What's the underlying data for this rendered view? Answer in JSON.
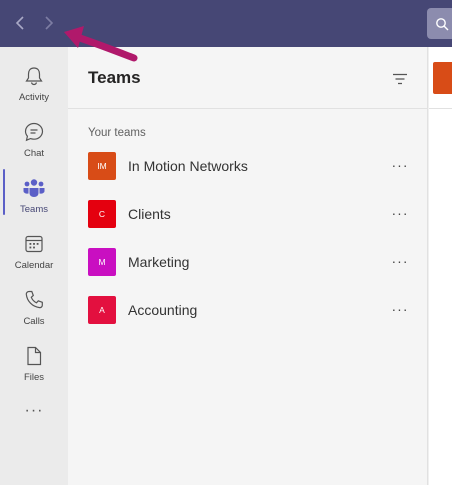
{
  "titlebar": {
    "back_icon": "chevron-left-icon",
    "forward_icon": "chevron-right-icon",
    "search_icon": "search-icon"
  },
  "rail": {
    "items": [
      {
        "label": "Activity",
        "icon": "bell-icon"
      },
      {
        "label": "Chat",
        "icon": "chat-icon"
      },
      {
        "label": "Teams",
        "icon": "teams-icon",
        "active": true
      },
      {
        "label": "Calendar",
        "icon": "calendar-icon"
      },
      {
        "label": "Calls",
        "icon": "phone-icon"
      },
      {
        "label": "Files",
        "icon": "file-icon"
      }
    ],
    "more": "···"
  },
  "panel": {
    "title": "Teams",
    "section_label": "Your teams",
    "teams": [
      {
        "initials": "IM",
        "name": "In Motion Networks",
        "color": "#d84c17"
      },
      {
        "initials": "C",
        "name": "Clients",
        "color": "#e4000f"
      },
      {
        "initials": "M",
        "name": "Marketing",
        "color": "#c90fc1"
      },
      {
        "initials": "A",
        "name": "Accounting",
        "color": "#e3103f"
      }
    ],
    "more_label": "···"
  },
  "colors": {
    "titlebar": "#464775",
    "accent": "#5b5fc7",
    "annotation_arrow": "#b0196b"
  }
}
